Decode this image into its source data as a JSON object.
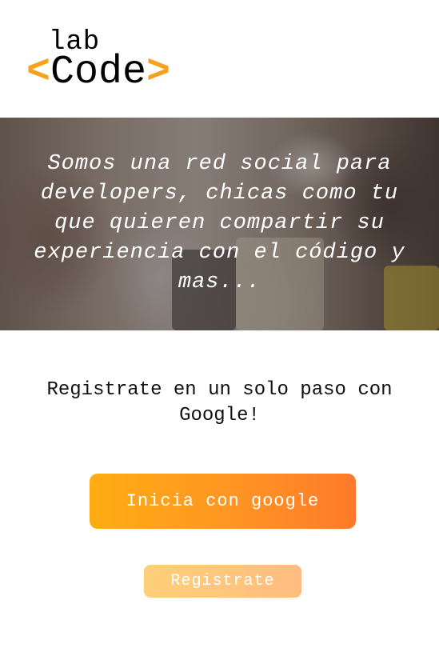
{
  "logo": {
    "top": "lab",
    "bracket_open": "<",
    "main": "Code",
    "bracket_close": ">",
    "accent_color": "#f7a21c"
  },
  "hero": {
    "text": "Somos una red social para developers, chicas como tu que quieren compartir su experiencia con el código y mas..."
  },
  "register": {
    "text": "Registrate en un solo paso con Google!"
  },
  "buttons": {
    "google_label": "Inicia con google",
    "register_label": "Registrate"
  },
  "colors": {
    "primary_gradient_start": "#ffac12",
    "primary_gradient_end": "#ff7a2b",
    "secondary_button": "#ffc67d"
  }
}
